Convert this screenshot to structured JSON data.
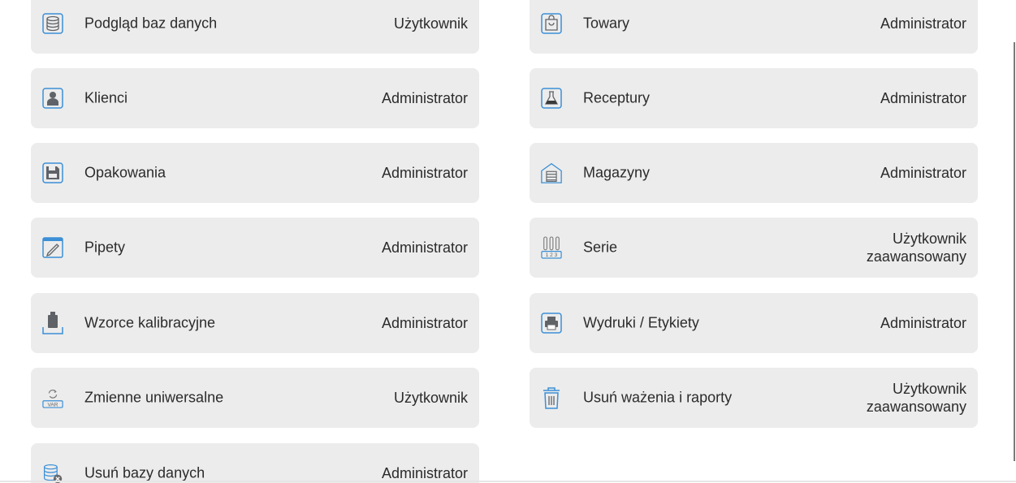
{
  "left_items": [
    {
      "label": "Podgląd baz danych",
      "role": [
        "Użytkownik"
      ],
      "icon": "database-stack-icon"
    },
    {
      "label": "Klienci",
      "role": [
        "Administrator"
      ],
      "icon": "person-icon"
    },
    {
      "label": "Opakowania",
      "role": [
        "Administrator"
      ],
      "icon": "floppy-box-icon"
    },
    {
      "label": "Pipety",
      "role": [
        "Administrator"
      ],
      "icon": "pipette-window-icon"
    },
    {
      "label": "Wzorce kalibracyjne",
      "role": [
        "Administrator"
      ],
      "icon": "calibration-weight-icon"
    },
    {
      "label": "Zmienne uniwersalne",
      "role": [
        "Użytkownik"
      ],
      "icon": "var-refresh-icon"
    },
    {
      "label": "Usuń bazy danych",
      "role": [
        "Administrator"
      ],
      "icon": "database-delete-icon"
    }
  ],
  "right_items": [
    {
      "label": "Towary",
      "role": [
        "Administrator"
      ],
      "icon": "shopping-bag-icon"
    },
    {
      "label": "Receptury",
      "role": [
        "Administrator"
      ],
      "icon": "flask-icon"
    },
    {
      "label": "Magazyny",
      "role": [
        "Administrator"
      ],
      "icon": "warehouse-icon"
    },
    {
      "label": "Serie",
      "role": [
        "Użytkownik",
        "zaawansowany"
      ],
      "icon": "test-tubes-123-icon"
    },
    {
      "label": "Wydruki / Etykiety",
      "role": [
        "Administrator"
      ],
      "icon": "printer-icon"
    },
    {
      "label": "Usuń ważenia i raporty",
      "role": [
        "Użytkownik",
        "zaawansowany"
      ],
      "icon": "trash-icon"
    }
  ],
  "colors": {
    "tile": "#ececec",
    "icon_blue": "#3b8fd6",
    "icon_gray": "#5f6368",
    "text": "#2b2b2b"
  }
}
